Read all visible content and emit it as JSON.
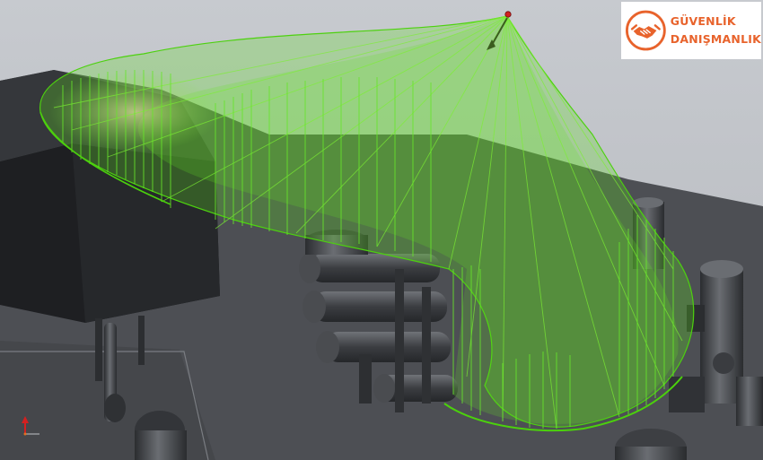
{
  "logo": {
    "line1": "GÜVENLİK",
    "line2": "DANIŞMANLIK",
    "icon": "handshake-icon",
    "color": "#e8632c"
  },
  "colors": {
    "sky": "#c9ccd0",
    "ground": "#505257",
    "plume_fill": "#5ee020",
    "plume_stroke": "#4dd10f",
    "equipment": "#3a3c40"
  }
}
